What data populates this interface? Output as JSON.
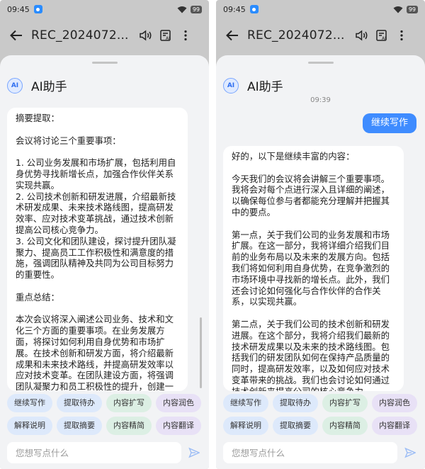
{
  "status": {
    "time": "09:45",
    "badge": "HD",
    "battery": "99"
  },
  "appbar": {
    "title": "REC_2024072..."
  },
  "assistant": {
    "title": "AI助手"
  },
  "left": {
    "message": "摘要提取：\n\n会议将讨论三个重要事项：\n\n1. 公司业务发展和市场扩展，包括利用自身优势寻找新增长点，加强合作伙伴关系实现共赢。\n2. 公司技术创新和研发进展，介绍最新技术研发成果、未来技术路线图，提高研发效率、应对技术变革挑战，通过技术创新提高公司核心竞争力。\n3. 公司文化和团队建设，探讨提升团队凝聚力、提高员工工作积极性和满意度的措施，强调团队精神及共同为公司目标努力的重要性。\n\n重点总结：\n\n本次会议将深入阐述公司业务、技术和文化三个方面的重要事项。在业务发展方面，将探讨如何利用自身优势和市场扩展。在技术创新和研发方面，将介绍最新成果和未来技术路线，并提高研发效率以应对技术变革。在团队建设方面，将强调团队凝聚力和员工积极性的提升，创建一个积极向上的工作环境。"
  },
  "right": {
    "timestamp": "09:39",
    "user_message": "继续写作",
    "message": "好的，以下是继续丰富的内容：\n\n今天我们的会议将会讲解三个重要事项。我将会对每个点进行深入且详细的阐述，以确保每位参与者都能充分理解并把握其中的要点。\n\n第一点，关于我们公司的业务发展和市场扩展。在这一部分，我将详细介绍我们目前的业务布局以及未来的发展方向。包括我们将如何利用自身优势，在竞争激烈的市场环境中寻找新的增长点。此外，我们还会讨论如何强化与合作伙伴的合作关系，以实现共赢。\n\n第二点，关于我们公司的技术创新和研发进展。在这个部分，我将介绍我们最新的技术研发成果以及未来的技术路线图。包括我们的研发团队如何在保持产品质量的同时，提高研发效率，以及如何应对技术变革带来的挑战。我们也会讨论如何通过技术创新来提高公司的核心竞争力。"
  },
  "chips": {
    "row1": [
      "继续写作",
      "提取待办",
      "内容扩写",
      "内容润色"
    ],
    "row2": [
      "解释说明",
      "提取摘要",
      "内容精简",
      "内容翻译"
    ]
  },
  "input": {
    "placeholder": "您想写点什么"
  },
  "colors": {
    "accent": "#3f8cff",
    "chip_blue": "#dde9fb",
    "chip_green": "#dcefe4",
    "chip_purple": "#e8e1f6"
  }
}
